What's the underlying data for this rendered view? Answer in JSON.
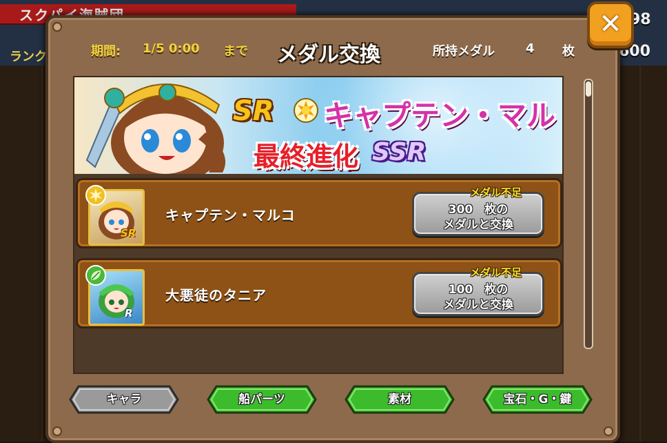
{
  "background": {
    "top_label": "スクパイ海賊団",
    "rank_label": "ランク",
    "right_number_top": "98",
    "right_number_bottom": "600"
  },
  "dialog": {
    "title": "メダル交換",
    "period_label": "期間:",
    "period_value": "1/5 0:00",
    "period_until": "まで",
    "owned_label": "所持メダル",
    "owned_count": "4",
    "owned_unit": "枚",
    "close_icon": "close-icon"
  },
  "banner": {
    "rarity": "SR",
    "character_name": "キャプテン・マルコ",
    "evolution_text": "最終進化",
    "evolution_rarity": "SSR"
  },
  "items": [
    {
      "name": "キャプテン・マルコ",
      "element": "sun",
      "rarity": "SR",
      "shortage": "メダル不足",
      "cost_line": "300　枚の",
      "action_line": "メダルと交換"
    },
    {
      "name": "大悪徒のタニア",
      "element": "leaf",
      "rarity": "R",
      "shortage": "メダル不足",
      "cost_line": "100　枚の",
      "action_line": "メダルと交換"
    }
  ],
  "tabs": [
    {
      "label": "キャラ",
      "color": "#9a9a9a"
    },
    {
      "label": "船パーツ",
      "color": "#3cbc2c"
    },
    {
      "label": "素材",
      "color": "#3cbc2c"
    },
    {
      "label": "宝石・G・鍵",
      "color": "#3cbc2c"
    }
  ],
  "colors": {
    "panel": "#8d6a4b",
    "row": "#8e5216",
    "accent_yellow": "#f4d23c",
    "close_orange": "#f2a020"
  }
}
